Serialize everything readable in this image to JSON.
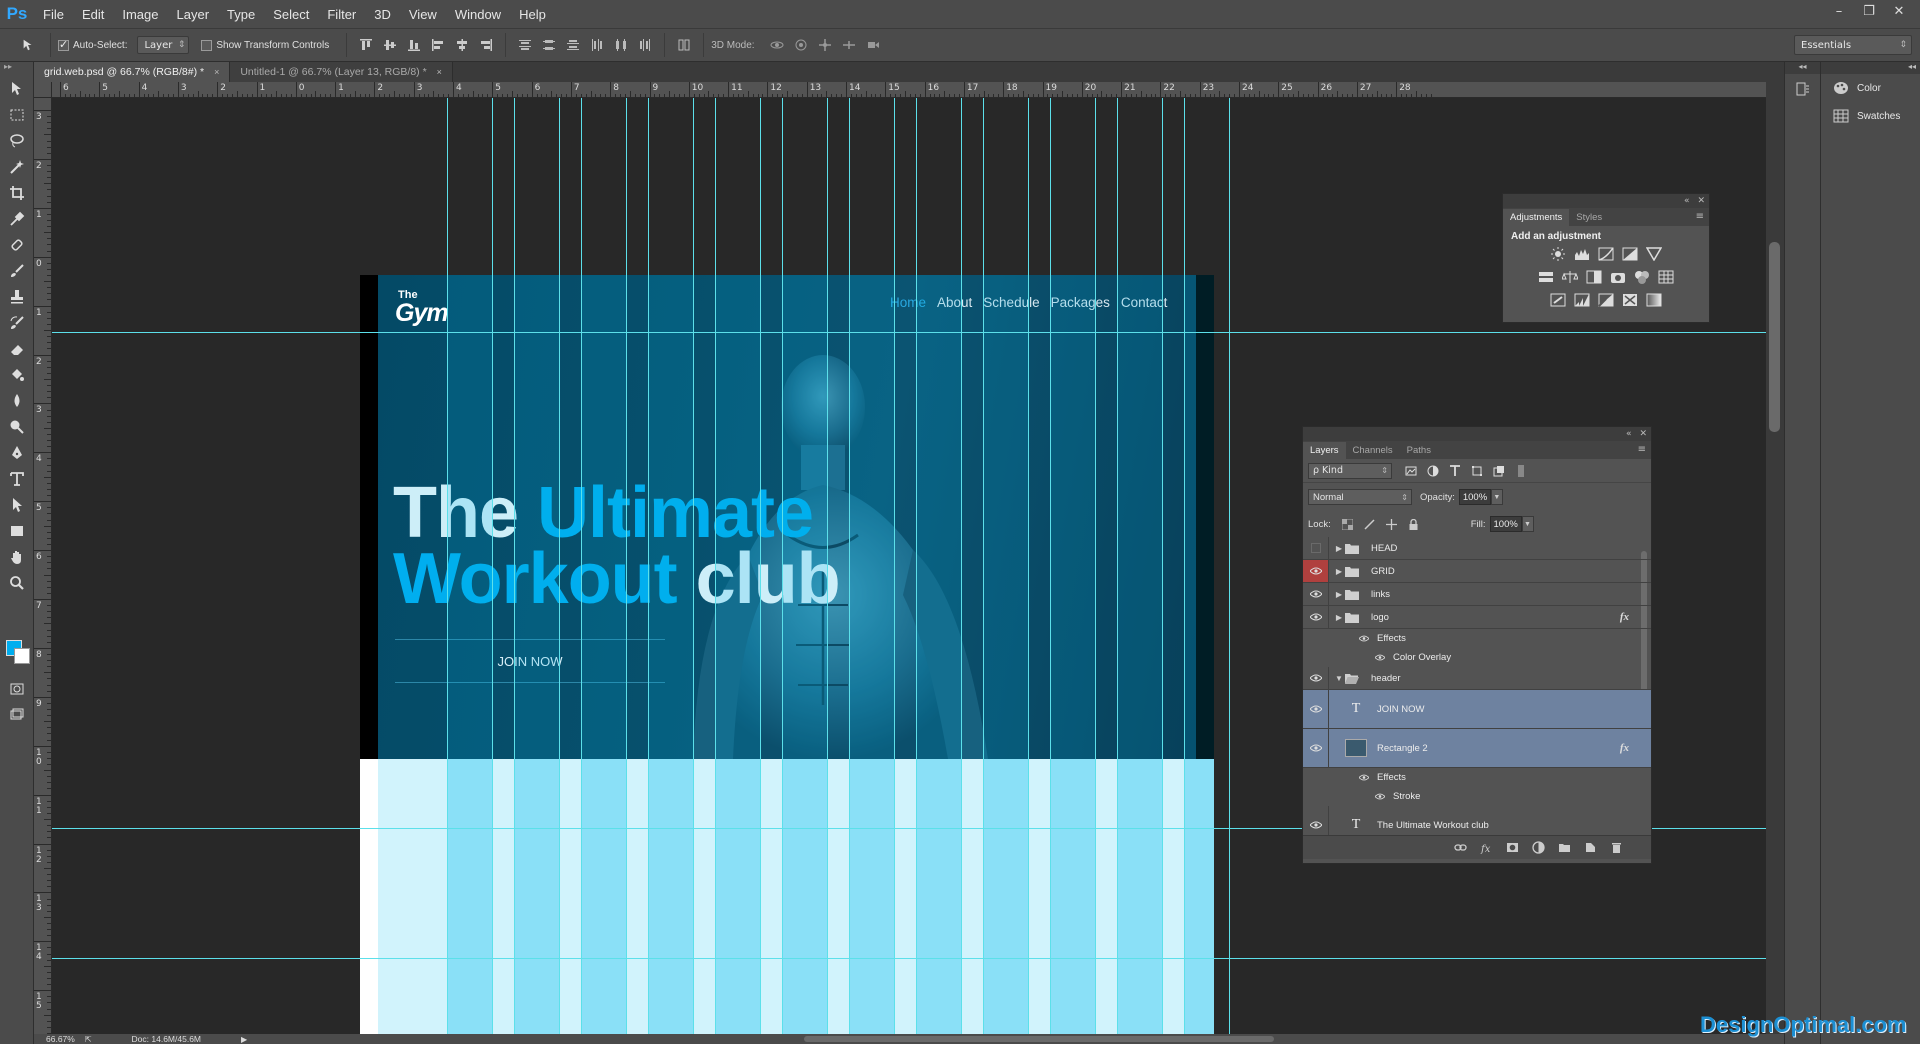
{
  "app": {
    "logo": "Ps",
    "menu": [
      "File",
      "Edit",
      "Image",
      "Layer",
      "Type",
      "Select",
      "Filter",
      "3D",
      "View",
      "Window",
      "Help"
    ],
    "window_buttons": [
      "–",
      "❐",
      "✕"
    ]
  },
  "options_bar": {
    "auto_select_label": "Auto-Select:",
    "auto_select_checked": true,
    "auto_select_target": "Layer",
    "show_transform_label": "Show Transform Controls",
    "show_transform_checked": false,
    "mode_label": "3D Mode:",
    "workspace": "Essentials"
  },
  "tabs": [
    {
      "title": "grid.web.psd @ 66.7% (RGB/8#) *",
      "close": "×",
      "active": true
    },
    {
      "title": "Untitled-1 @ 66.7% (Layer 13, RGB/8) *",
      "close": "×",
      "active": false
    }
  ],
  "ruler": {
    "h_labels": [
      "6",
      "5",
      "4",
      "3",
      "2",
      "1",
      "0",
      "1",
      "2",
      "3",
      "4",
      "5",
      "6",
      "7",
      "8",
      "9",
      "10",
      "11",
      "12",
      "13",
      "14",
      "15",
      "16",
      "17",
      "18",
      "19",
      "20",
      "21",
      "22",
      "23",
      "24",
      "25",
      "26",
      "27",
      "28"
    ],
    "v_labels": [
      "3",
      "2",
      "1",
      "0",
      "1",
      "2",
      "3",
      "4",
      "5",
      "6",
      "7",
      "8",
      "9",
      "10",
      "11",
      "12",
      "13",
      "14",
      "15"
    ]
  },
  "website": {
    "logo_the": "The",
    "logo_gym": "Gym",
    "nav": [
      "Home",
      "About",
      "Schedule",
      "Packages",
      "Contact"
    ],
    "nav_active_index": 0,
    "headline_1a": "The ",
    "headline_1b": "Ultimate",
    "headline_2a": "Workout",
    "headline_2b": " club",
    "cta": "JOIN NOW"
  },
  "adjustments_panel": {
    "tabs": [
      "Adjustments",
      "Styles"
    ],
    "title": "Add an adjustment",
    "controls": [
      "«",
      "✕"
    ],
    "menu": "≡"
  },
  "layers_panel": {
    "tabs": [
      "Layers",
      "Channels",
      "Paths"
    ],
    "controls": [
      "«",
      "✕"
    ],
    "menu": "≡",
    "filter_kind": "ρ Kind",
    "blend_mode": "Normal",
    "opacity_label": "Opacity:",
    "opacity": "100%",
    "lock_label": "Lock:",
    "fill_label": "Fill:",
    "fill": "100%",
    "fx_symbol": "fx",
    "type_symbol": "T",
    "layers": [
      {
        "name": "HEAD",
        "kind": "group",
        "visible": false
      },
      {
        "name": "GRID",
        "kind": "group",
        "visible": true,
        "eye_highlight": true
      },
      {
        "name": "links",
        "kind": "group",
        "visible": true
      },
      {
        "name": "logo",
        "kind": "group",
        "visible": true,
        "fx": true
      },
      {
        "name": "Effects",
        "kind": "effects"
      },
      {
        "name": "Color Overlay",
        "kind": "effect"
      },
      {
        "name": "header",
        "kind": "group-open",
        "visible": true
      },
      {
        "name": "JOIN NOW",
        "kind": "text",
        "visible": true,
        "selected": true
      },
      {
        "name": "Rectangle 2",
        "kind": "shape",
        "visible": true,
        "selected": true,
        "fx": true
      },
      {
        "name": "Effects",
        "kind": "effects"
      },
      {
        "name": "Stroke",
        "kind": "effect"
      },
      {
        "name": "The Ultimate  Workout club",
        "kind": "text",
        "visible": true
      }
    ]
  },
  "right_dock": {
    "items": [
      {
        "label": "Color",
        "icon": "palette-icon"
      },
      {
        "label": "Swatches",
        "icon": "swatches-grid-icon"
      }
    ]
  },
  "status": {
    "zoom": "66.67%",
    "doc": "Doc: 14.6M/45.6M"
  },
  "watermark": "DesignOptimal.com",
  "colors": {
    "accent": "#00aeef",
    "guide": "#5ce0ea",
    "hero_bg": "#07506d",
    "layer_selected": "#6e82a0",
    "eye_highlight": "#b0403e"
  }
}
